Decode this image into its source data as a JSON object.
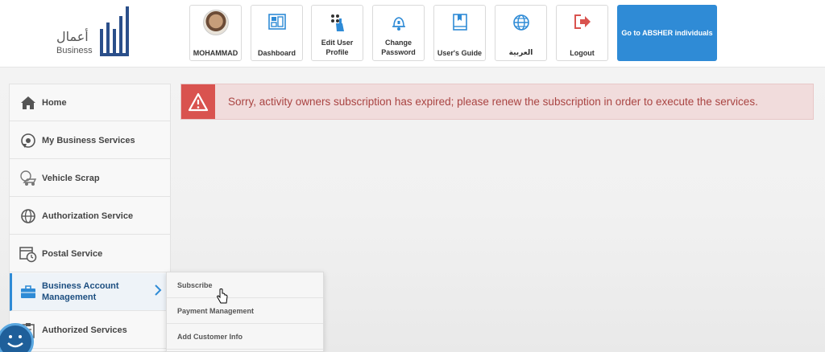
{
  "header": {
    "logo": {
      "arabic": "أعمال",
      "english": "Business"
    },
    "nav": [
      {
        "id": "profile",
        "label": "MOHAMMAD",
        "icon": "avatar"
      },
      {
        "id": "dashboard",
        "label": "Dashboard",
        "icon": "dashboard-icon"
      },
      {
        "id": "edit-profile",
        "label": "Edit User Profile",
        "icon": "edit-user-icon"
      },
      {
        "id": "change-password",
        "label": "Change Password",
        "icon": "bell-lock-icon"
      },
      {
        "id": "users-guide",
        "label": "User's Guide",
        "icon": "book-icon"
      },
      {
        "id": "language",
        "label": "العربية",
        "icon": "globe-icon"
      },
      {
        "id": "logout",
        "label": "Logout",
        "icon": "logout-icon"
      }
    ],
    "absher_button": "Go to ABSHER individuals"
  },
  "sidebar": {
    "items": [
      {
        "label": "Home",
        "icon": "home-icon"
      },
      {
        "label": "My Business Services",
        "icon": "business-services-icon"
      },
      {
        "label": "Vehicle Scrap",
        "icon": "vehicle-icon"
      },
      {
        "label": "Authorization Service",
        "icon": "globe-icon"
      },
      {
        "label": "Postal Service",
        "icon": "calendar-clock-icon"
      },
      {
        "label": "Business Account Management",
        "icon": "briefcase-icon",
        "active": true
      },
      {
        "label": "Authorized Services",
        "icon": "clipboard-icon"
      }
    ]
  },
  "submenu": {
    "items": [
      {
        "label": "Subscribe"
      },
      {
        "label": "Payment Management"
      },
      {
        "label": "Add Customer Info"
      }
    ]
  },
  "alert": {
    "message": "Sorry, activity owners subscription has expired; please renew the subscription in order to execute the services."
  },
  "colors": {
    "accent": "#2f8bd6",
    "alert_bg": "#f1dcdc",
    "alert_icon": "#d9534f",
    "alert_text": "#a94442"
  }
}
